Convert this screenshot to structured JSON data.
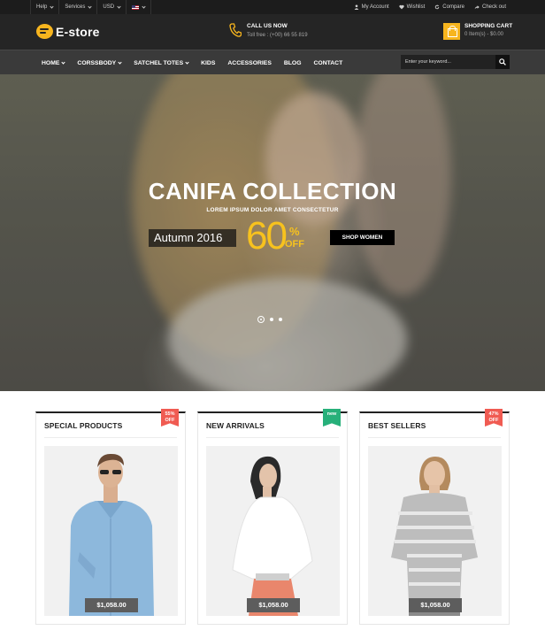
{
  "colors": {
    "accent": "#f7b51e",
    "header_bg": "#252525",
    "nav_bg": "#3a3a3a",
    "topbar_bg": "#1c1c1c",
    "sale_red": "#f05b52",
    "new_green": "#27b07a"
  },
  "topbar": {
    "left": [
      {
        "label": "Help",
        "icon": "chevron-down-icon"
      },
      {
        "label": "Services",
        "icon": "chevron-down-icon"
      },
      {
        "label": "USD",
        "icon": "chevron-down-icon"
      },
      {
        "label": "",
        "icon": "us-flag-icon"
      }
    ],
    "right": [
      {
        "label": "My Account",
        "icon": "user-icon"
      },
      {
        "label": "Wishlist",
        "icon": "heart-icon"
      },
      {
        "label": "Compare",
        "icon": "refresh-icon"
      },
      {
        "label": "Check out",
        "icon": "share-icon"
      }
    ]
  },
  "header": {
    "logo_text": "E-store",
    "call_title": "CALL US NOW",
    "call_number": "Toll free : (+00) 66 55 819",
    "cart_title": "SHOPPING CART",
    "cart_summary": "0 Item(s) - $0.00"
  },
  "nav": {
    "items": [
      {
        "label": "HOME",
        "dropdown": true
      },
      {
        "label": "CORSSBODY",
        "dropdown": true
      },
      {
        "label": "SATCHEL TOTES",
        "dropdown": true
      },
      {
        "label": "KIDS",
        "dropdown": false
      },
      {
        "label": "ACCESSORIES",
        "dropdown": false
      },
      {
        "label": "BLOG",
        "dropdown": false
      },
      {
        "label": "CONTACT",
        "dropdown": false
      }
    ],
    "search_placeholder": "Enter your keyword..."
  },
  "hero": {
    "title": "CANIFA COLLECTION",
    "subtitle": "LOREM IPSUM DOLOR AMET CONSECTETUR",
    "season": "Autumn 2016",
    "discount_number": "60",
    "discount_percent": "%",
    "discount_off": "OFF",
    "button": "SHOP WOMEN",
    "slides": 3,
    "active_slide": 1
  },
  "sections": [
    {
      "title": "SPECIAL PRODUCTS",
      "ribbon": "55% OFF",
      "ribbon_color": "red",
      "price": "$1,058.00",
      "image": "man-in-blue-denim-shirt"
    },
    {
      "title": "NEW ARRIVALS",
      "ribbon": "new",
      "ribbon_color": "green",
      "price": "$1,058.00",
      "image": "woman-in-white-cape-blouse"
    },
    {
      "title": "BEST SELLERS",
      "ribbon": "47% OFF",
      "ribbon_color": "red",
      "price": "$1,058.00",
      "image": "woman-in-striped-sweater"
    }
  ]
}
